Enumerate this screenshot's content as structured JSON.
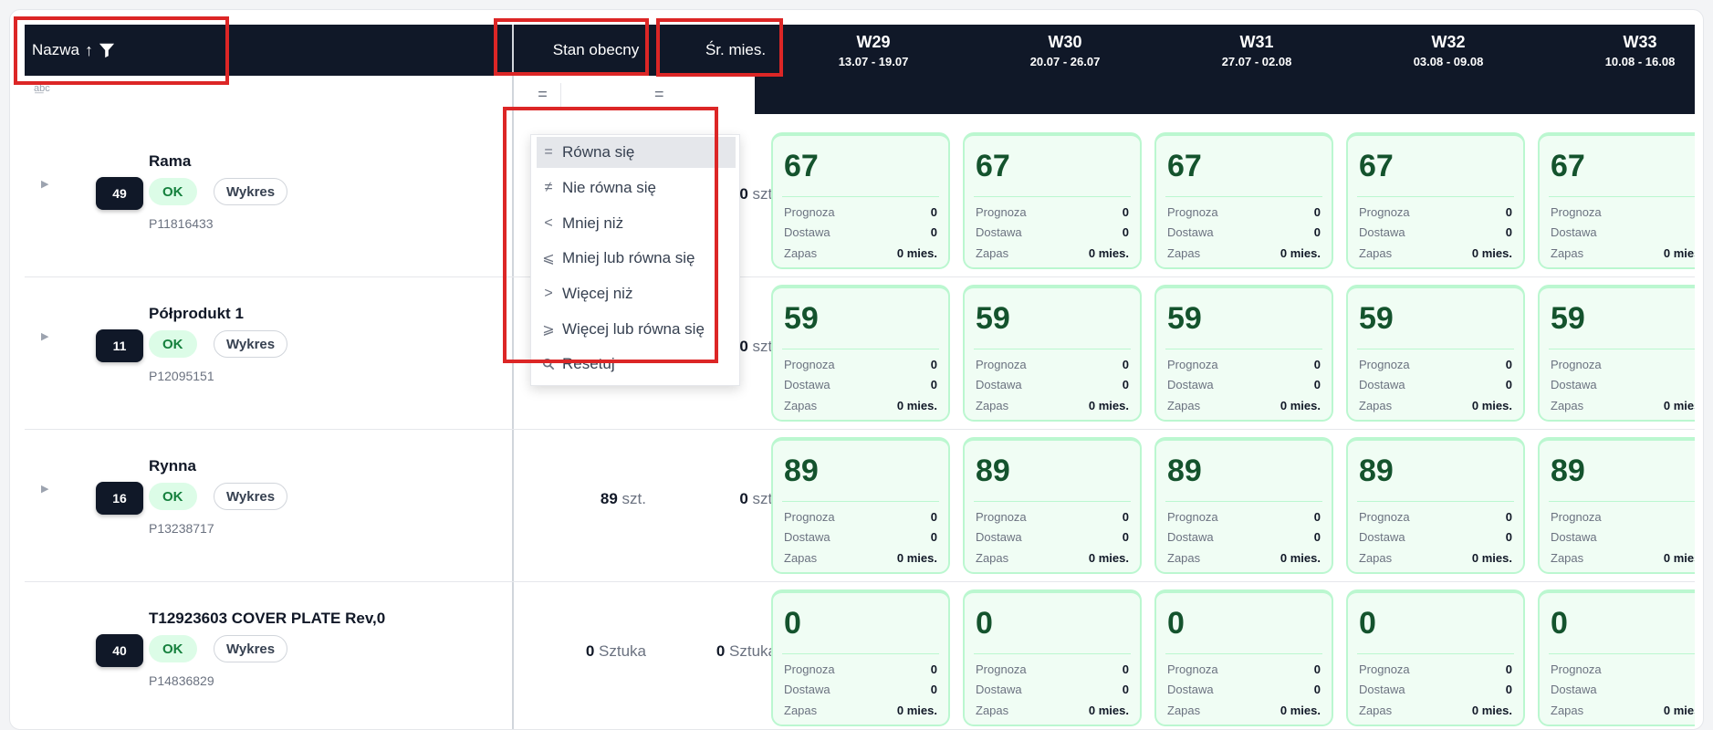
{
  "header": {
    "name_label": "Nazwa",
    "sort_arrow": "↑",
    "stan_label": "Stan obecny",
    "sr_label": "Śr. mies.",
    "weeks": [
      {
        "label": "W29",
        "range": "13.07 - 19.07"
      },
      {
        "label": "W30",
        "range": "20.07 - 26.07"
      },
      {
        "label": "W31",
        "range": "27.07 - 02.08"
      },
      {
        "label": "W32",
        "range": "03.08 - 09.08"
      },
      {
        "label": "W33",
        "range": "10.08 - 16.08"
      }
    ]
  },
  "filter_bar": {
    "text_filter_icon": "a͟bc",
    "eq1": "=",
    "eq2": "="
  },
  "dropdown": {
    "items": [
      {
        "symbol": "=",
        "label": "Równa się",
        "active": true
      },
      {
        "symbol": "≠",
        "label": "Nie równa się"
      },
      {
        "symbol": "<",
        "label": "Mniej niż"
      },
      {
        "symbol": "⩽",
        "label": "Mniej lub równa się"
      },
      {
        "symbol": ">",
        "label": "Więcej niż"
      },
      {
        "symbol": "⩾",
        "label": "Więcej lub równa się"
      },
      {
        "symbol": "🔍",
        "label": "Resetuj"
      }
    ]
  },
  "card_labels": {
    "prognoza": "Prognoza",
    "dostawa": "Dostawa",
    "zapas": "Zapas"
  },
  "status_ok": "OK",
  "chart_button": "Wykres",
  "rows": [
    {
      "badge": "49",
      "name": "Rama",
      "code": "P11816433",
      "stan": "",
      "stan_unit": "",
      "sr": "0",
      "sr_unit": "szt.",
      "week_value": "67",
      "prognoza": "0",
      "dostawa": "0",
      "zapas": "0 mies.",
      "has_caret": true
    },
    {
      "badge": "11",
      "name": "Półprodukt 1",
      "code": "P12095151",
      "stan": "",
      "stan_unit": "",
      "sr": "0",
      "sr_unit": "szt.",
      "week_value": "59",
      "prognoza": "0",
      "dostawa": "0",
      "zapas": "0 mies.",
      "has_caret": true
    },
    {
      "badge": "16",
      "name": "Rynna",
      "code": "P13238717",
      "stan": "89",
      "stan_unit": "szt.",
      "sr": "0",
      "sr_unit": "szt.",
      "week_value": "89",
      "prognoza": "0",
      "dostawa": "0",
      "zapas": "0 mies.",
      "has_caret": true
    },
    {
      "badge": "40",
      "name": "T12923603 COVER PLATE Rev,0",
      "code": "P14836829",
      "stan": "0",
      "stan_unit": "Sztuka",
      "sr": "0",
      "sr_unit": "Sztuka",
      "week_value": "0",
      "prognoza": "0",
      "dostawa": "0",
      "zapas": "0 mies.",
      "has_caret": false
    }
  ],
  "colors": {
    "header_bg": "#101828",
    "card_bg": "#f0fdf4",
    "card_border": "#bbf7d0",
    "highlight": "#dc2626",
    "ok_bg": "#dcfce7"
  }
}
